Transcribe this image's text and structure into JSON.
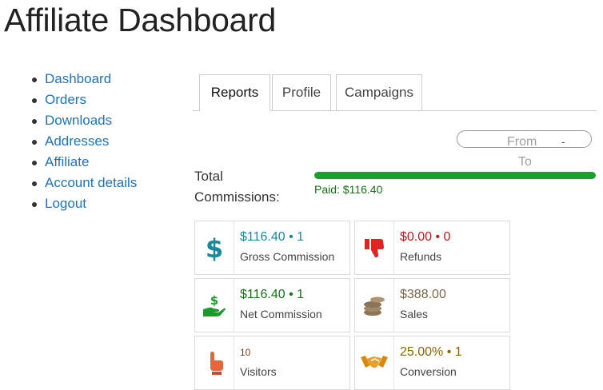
{
  "page": {
    "title": "Affiliate Dashboard"
  },
  "nav": [
    {
      "label": "Dashboard"
    },
    {
      "label": "Orders"
    },
    {
      "label": "Downloads"
    },
    {
      "label": "Addresses"
    },
    {
      "label": "Affiliate"
    },
    {
      "label": "Account details"
    },
    {
      "label": "Logout"
    }
  ],
  "tabs": [
    {
      "label": "Reports",
      "active": true
    },
    {
      "label": "Profile",
      "active": false
    },
    {
      "label": "Campaigns",
      "active": false
    }
  ],
  "date_range": {
    "from_placeholder": "From",
    "separator": "-",
    "to_placeholder": "To"
  },
  "commissions": {
    "label_line1": "Total",
    "label_line2": "Commissions:",
    "paid_label": "Paid: $116.40",
    "paid_fraction": 1.0,
    "bar_color": "#1aa12c"
  },
  "cards": [
    {
      "value": "$116.40 • 1",
      "label": "Gross Commission",
      "icon": "dollar-icon",
      "color": "#1a8a9a"
    },
    {
      "value": "$0.00 • 0",
      "label": "Refunds",
      "icon": "thumbs-down-icon",
      "color": "#c41a1a"
    },
    {
      "value": "$116.40 • 1",
      "label": "Net Commission",
      "icon": "hand-dollar-icon",
      "color": "#187318"
    },
    {
      "value": "$388.00",
      "label": "Sales",
      "icon": "coins-icon",
      "color": "#7a6548"
    },
    {
      "value": "10",
      "label": "Visitors",
      "icon": "pointer-hand-icon",
      "color": "#7a3b1a"
    },
    {
      "value": "25.00% • 1",
      "label": "Conversion",
      "icon": "handshake-icon",
      "color": "#8a6400"
    }
  ]
}
